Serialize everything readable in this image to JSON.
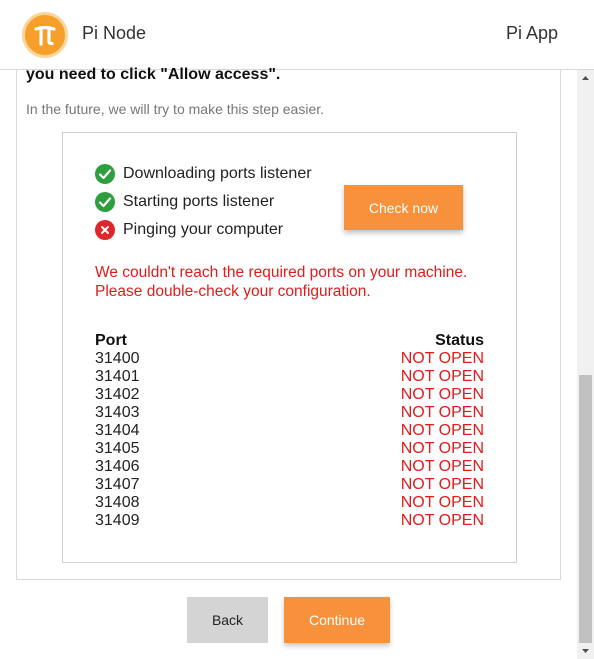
{
  "header": {
    "title": "Pi Node",
    "right_label": "Pi App",
    "logo_icon": "pi-logo-icon"
  },
  "intro": {
    "bold_text": "you need to click \"Allow access\".",
    "note": "In the future, we will try to make this step easier."
  },
  "steps": [
    {
      "label": "Downloading ports listener",
      "status": "success",
      "icon": "check-circle-icon"
    },
    {
      "label": "Starting ports listener",
      "status": "success",
      "icon": "check-circle-icon"
    },
    {
      "label": "Pinging your computer",
      "status": "error",
      "icon": "x-circle-icon"
    }
  ],
  "check_button": "Check now",
  "error": {
    "line1": "We couldn't reach the required ports on your machine.",
    "line2": "Please double-check your configuration."
  },
  "ports_table": {
    "headers": [
      "Port",
      "Status"
    ],
    "rows": [
      [
        "31400",
        "NOT OPEN"
      ],
      [
        "31401",
        "NOT OPEN"
      ],
      [
        "31402",
        "NOT OPEN"
      ],
      [
        "31403",
        "NOT OPEN"
      ],
      [
        "31404",
        "NOT OPEN"
      ],
      [
        "31405",
        "NOT OPEN"
      ],
      [
        "31406",
        "NOT OPEN"
      ],
      [
        "31407",
        "NOT OPEN"
      ],
      [
        "31408",
        "NOT OPEN"
      ],
      [
        "31409",
        "NOT OPEN"
      ]
    ]
  },
  "footer": {
    "back": "Back",
    "continue": "Continue"
  },
  "colors": {
    "accent": "#f7913b",
    "success": "#2e9e3e",
    "error": "#e21b1b",
    "logo": "#f6a02b"
  }
}
